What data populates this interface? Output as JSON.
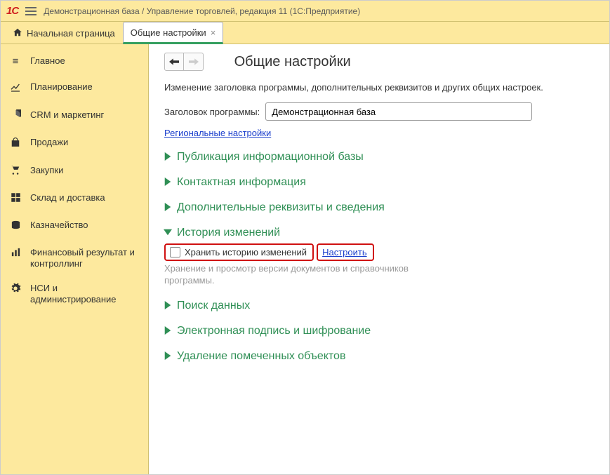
{
  "titlebar": {
    "logo": "1C",
    "title": "Демонстрационная база / Управление торговлей, редакция 11  (1С:Предприятие)"
  },
  "tabs": {
    "home": "Начальная страница",
    "active": "Общие настройки"
  },
  "sidebar": {
    "items": [
      {
        "icon": "≡",
        "label": "Главное"
      },
      {
        "icon": "chart",
        "label": "Планирование"
      },
      {
        "icon": "pie",
        "label": "CRM и маркетинг"
      },
      {
        "icon": "bag",
        "label": "Продажи"
      },
      {
        "icon": "cart",
        "label": "Закупки"
      },
      {
        "icon": "boxes",
        "label": "Склад и доставка"
      },
      {
        "icon": "coins",
        "label": "Казначейство"
      },
      {
        "icon": "bars",
        "label": "Финансовый результат и контроллинг"
      },
      {
        "icon": "gear",
        "label": "НСИ и администрирование"
      }
    ]
  },
  "main": {
    "page_title": "Общие настройки",
    "description": "Изменение заголовка программы, дополнительных реквизитов и других общих настроек.",
    "program_title_label": "Заголовок программы:",
    "program_title_value": "Демонстрационная база",
    "regional_link": "Региональные настройки",
    "sections": {
      "s1": "Публикация информационной базы",
      "s2": "Контактная информация",
      "s3": "Дополнительные реквизиты и сведения",
      "s4": "История изменений",
      "s5": "Поиск данных",
      "s6": "Электронная подпись и шифрование",
      "s7": "Удаление помеченных объектов"
    },
    "history": {
      "checkbox_label": "Хранить историю изменений",
      "configure_link": "Настроить",
      "hint": "Хранение и просмотр версии документов и справочников программы."
    }
  }
}
